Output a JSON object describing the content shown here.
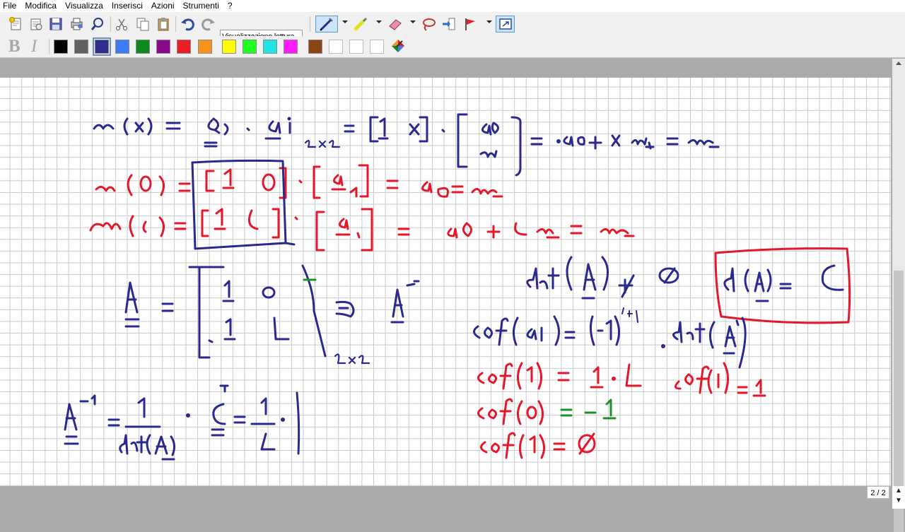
{
  "menu": {
    "items": [
      "File",
      "Modifica",
      "Visualizza",
      "Inserisci",
      "Azioni",
      "Strumenti",
      "?"
    ]
  },
  "toolbar": {
    "view_mode": "Visualizzazione lettura",
    "icons": [
      "new-page-icon",
      "open-icon",
      "save-icon",
      "print-icon",
      "zoom-icon",
      "cut-icon",
      "copy-icon",
      "paste-icon",
      "undo-icon",
      "redo-icon",
      "pen-icon",
      "highlighter-icon",
      "eraser-icon",
      "lasso-icon",
      "insert-space-icon",
      "flag-icon",
      "fit-window-icon"
    ]
  },
  "format_bar": {
    "bold_label": "B",
    "italic_label": "I",
    "colors": [
      "#000000",
      "#606060",
      "#2e2e8e",
      "#3d7bf7",
      "#0d8a1b",
      "#8a0a8a",
      "#ee1d24",
      "#f7941d",
      "#ffff00",
      "#21ff21",
      "#21e5e5",
      "#ff1bff",
      "#8b4513",
      "#ffffff",
      "#ffffff",
      "#ffffff"
    ],
    "selected_color": "#2e2e8e"
  },
  "pages": {
    "indicator": "2 / 2"
  }
}
